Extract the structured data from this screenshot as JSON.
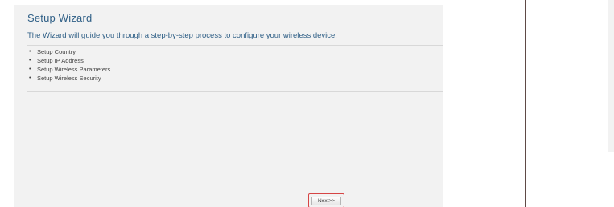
{
  "wizard": {
    "title": "Setup Wizard",
    "description": "The Wizard will guide you through a step-by-step process to configure your wireless device.",
    "steps": [
      {
        "label": "Setup Country"
      },
      {
        "label": "Setup IP Address"
      },
      {
        "label": "Setup Wireless Parameters"
      },
      {
        "label": "Setup Wireless Security"
      }
    ],
    "bullet": "•",
    "next_label": "Next>>"
  },
  "colors": {
    "title_text": "#2f5f86",
    "panel_background": "#f2f2f2",
    "highlight_border": "#d64545"
  }
}
